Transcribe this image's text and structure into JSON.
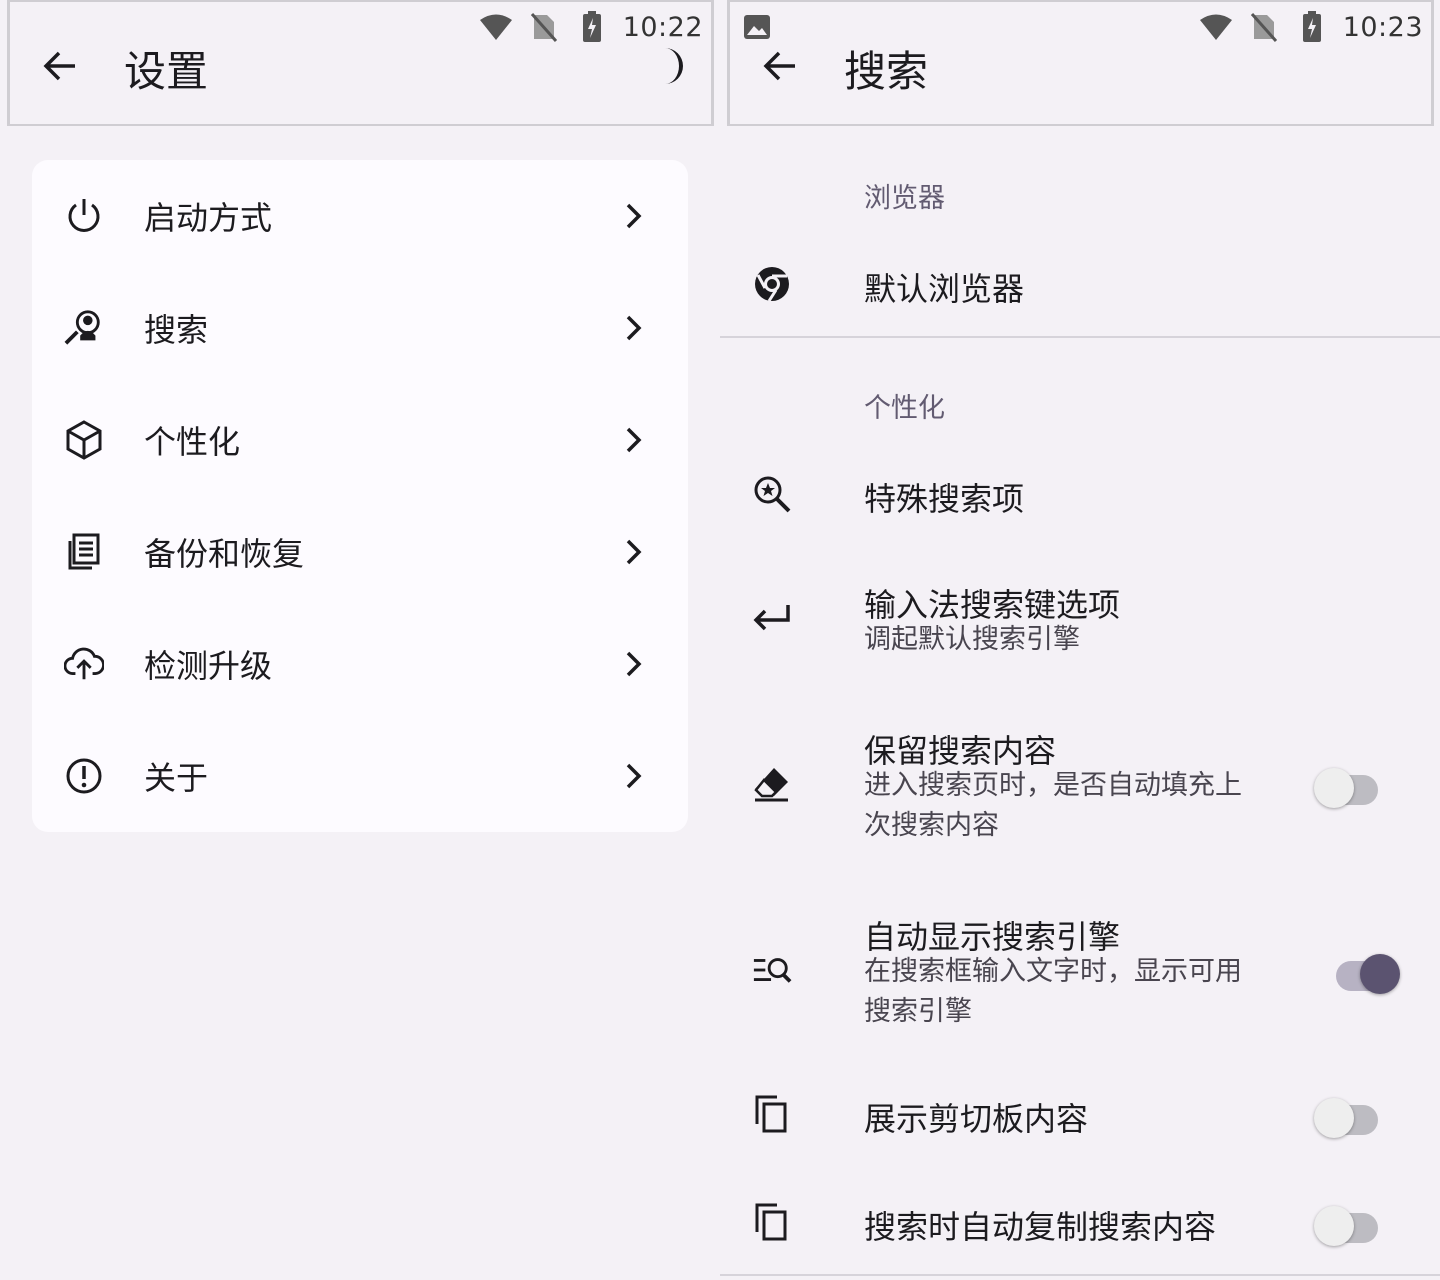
{
  "left": {
    "status": {
      "time": "10:22"
    },
    "title": "设置",
    "menu": [
      {
        "label": "启动方式",
        "icon": "power-icon"
      },
      {
        "label": "搜索",
        "icon": "search-person-icon"
      },
      {
        "label": "个性化",
        "icon": "cube-icon"
      },
      {
        "label": "备份和恢复",
        "icon": "document-copy-icon"
      },
      {
        "label": "检测升级",
        "icon": "cloud-upload-icon"
      },
      {
        "label": "关于",
        "icon": "info-alert-icon"
      }
    ]
  },
  "right": {
    "status": {
      "time": "10:23"
    },
    "title": "搜索",
    "sections": [
      {
        "title": "浏览器",
        "items": [
          {
            "title": "默认浏览器",
            "icon": "chrome-icon"
          }
        ]
      },
      {
        "title": "个性化",
        "items": [
          {
            "title": "特殊搜索项",
            "icon": "search-star-icon"
          },
          {
            "title": "输入法搜索键选项",
            "subtitle": "调起默认搜索引擎",
            "icon": "enter-key-icon"
          },
          {
            "title": "保留搜索内容",
            "subtitle": "进入搜索页时，是否自动填充上次搜索内容",
            "icon": "eraser-icon",
            "switch": false
          },
          {
            "title": "自动显示搜索引擎",
            "subtitle": "在搜索框输入文字时，显示可用搜索引擎",
            "icon": "list-search-icon",
            "switch": true
          },
          {
            "title": "展示剪切板内容",
            "icon": "clipboard-copy-icon",
            "switch": false
          },
          {
            "title": "搜索时自动复制搜索内容",
            "icon": "clipboard-copy-icon",
            "switch": false
          }
        ]
      }
    ]
  },
  "colors": {
    "background": "#f4f1f6",
    "card": "#fdfbff",
    "section_title": "#625b71",
    "switch_on_thumb": "#5b5370"
  }
}
